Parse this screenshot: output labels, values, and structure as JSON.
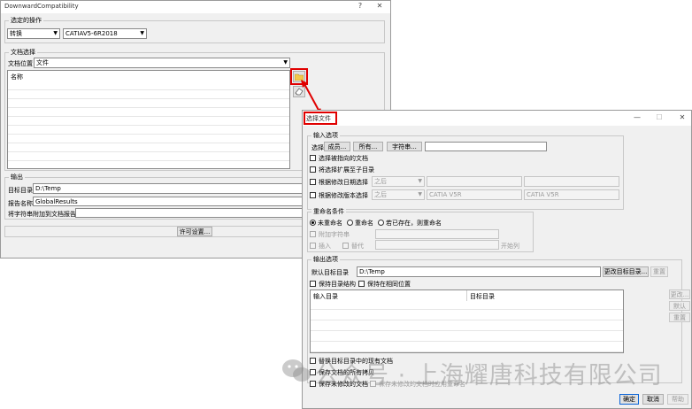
{
  "win1": {
    "title": "DownwardCompatibility",
    "help": "?",
    "close": "✕",
    "op_group": "选定的操作",
    "op_value": "转换",
    "target_value": "CATIAV5-6R2018",
    "doc_group": "文档选择",
    "doc_loc_label": "文档位置",
    "doc_loc_value": "文件",
    "name_header": "名称",
    "output_group": "输出",
    "target_dir_label": "目标目录",
    "target_dir_value": "D:\\Temp",
    "report_label": "报告名称",
    "report_value": "GlobalResults",
    "suffix_label": "将字符串附加到文档报告",
    "suffix_value": "",
    "license_button": "许可设置..."
  },
  "win2": {
    "title": "选择文件",
    "minimize": "—",
    "maximize": "☐",
    "close": "✕",
    "input_group": "输入选项",
    "select_label": "选择",
    "members_btn": "成员...",
    "all_btn": "所有...",
    "string_btn": "字符串...",
    "string_value": "",
    "opt_pointed": "选择被指向的文档",
    "opt_extend": "将选择扩展至子目录",
    "opt_by_date": "根据修改日期选择",
    "after1": "之后",
    "opt_by_version": "根据修改版本选择",
    "after2": "之后",
    "ver1": "CATIA V5R",
    "ver2": "CATIA V5R",
    "rename_group": "重命名条件",
    "rename_none": "未重命名",
    "rename_yes": "重命名",
    "rename_exist": "若已存在，则重命名",
    "append_string": "附加字符串",
    "insert": "插入",
    "replace": "替代",
    "start_position": "开始列",
    "output_group": "输出选项",
    "default_dir_label": "默认目标目录",
    "default_dir_value": "D:\\Temp",
    "change_dir_btn": "更改目标目录...",
    "reset_btn": "重置",
    "keep_structure": "保持目录结构",
    "keep_same": "保持在相同位置",
    "col_input": "输入目录",
    "col_target": "目标目录",
    "side_change": "更改...",
    "side_default": "默认",
    "side_reset": "重置",
    "opt_replace_existing": "替换目标目录中的现有文档",
    "opt_save_all": "保存文档的所有拷贝",
    "opt_save_unmodified": "保存未修改的文档",
    "opt_unmodified_note": "保存未修改的文档时应用重命名",
    "ok_btn": "确定",
    "cancel_btn": "取消",
    "help_btn": "帮助"
  },
  "watermark": "公众号 · 上海耀唐科技有限公司",
  "colors": {
    "highlight": "#e00000",
    "dialog_bg": "#f0f0f0",
    "folder_icon": "#f2c94c"
  }
}
